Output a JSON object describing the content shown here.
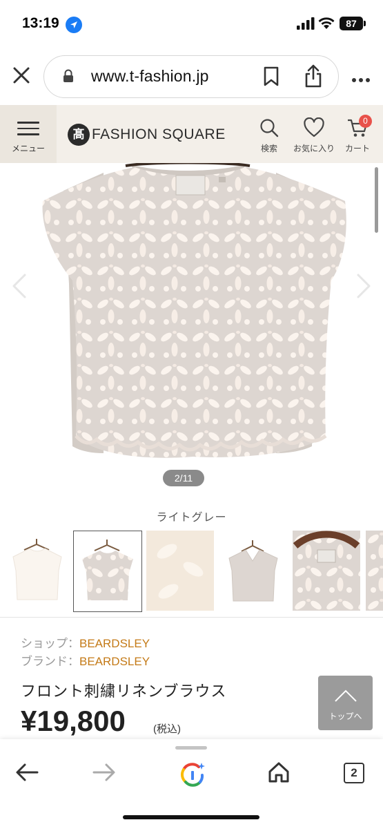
{
  "status_bar": {
    "time": "13:19",
    "battery": "87"
  },
  "browser": {
    "url": "www.t-fashion.jp",
    "icons": [
      "close-icon",
      "lock-icon",
      "bookmark-icon",
      "share-icon",
      "more-icon"
    ]
  },
  "site_header": {
    "menu_label": "メニュー",
    "logo_mark": "髙",
    "logo_text": "FASHION SQUARE",
    "search_label": "検索",
    "favorites_label": "お気に入り",
    "cart_label": "カート",
    "cart_count": "0",
    "accent_color": "#e8514a"
  },
  "gallery": {
    "counter": "2/11",
    "color_name": "ライトグレー"
  },
  "product": {
    "shop_label": "ショップ：",
    "shop_value": "BEARDSLEY",
    "brand_label": "ブランド：",
    "brand_value": "BEARDSLEY",
    "title": "フロント刺繍リネンブラウス",
    "price": "¥19,800",
    "tax_note": "(税込)",
    "link_color": "#c47a17"
  },
  "to_top": {
    "label": "トップへ"
  },
  "bottom_bar": {
    "tab_count": "2",
    "icons": [
      "back-icon",
      "forward-icon",
      "google-lens-icon",
      "home-icon",
      "tabs-icon"
    ]
  }
}
